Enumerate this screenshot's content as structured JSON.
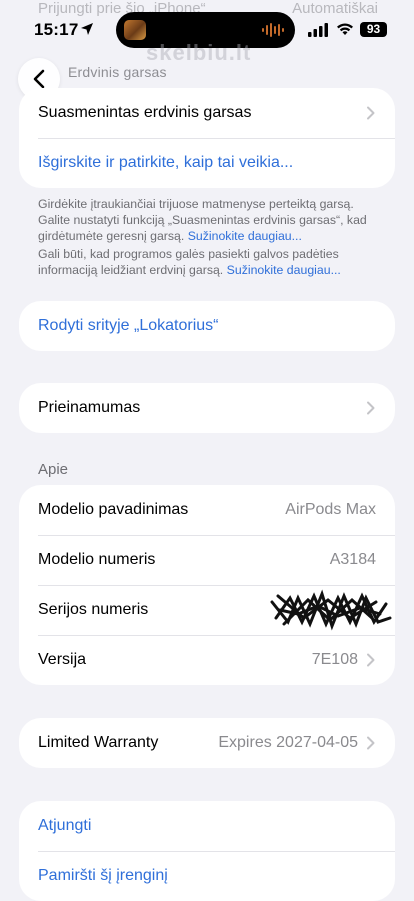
{
  "ghost_header": {
    "label": "Prijungti prie šio „iPhone“",
    "value": "Automatiškai"
  },
  "status_bar": {
    "time": "15:17",
    "battery": "93"
  },
  "watermark": "skelbiu.lt",
  "section_cut_title": "Erdvinis garsas",
  "spatial_audio_card": {
    "personalized_label": "Suasmenintas erdvinis garsas",
    "hear_link": "Išgirskite ir patirkite, kaip tai veikia..."
  },
  "footnotes": {
    "first_text": "Girdėkite įtraukiančiai trijuose matmenyse perteiktą garsą. Galite nustatyti funkciją „Suasmenintas erdvinis garsas“, kad girdėtumėte geresnį garsą.",
    "first_link": "Sužinokite daugiau...",
    "second_text": "Gali būti, kad programos galės pasiekti galvos padėties informaciją leidžiant erdvinį garsą.",
    "second_link": "Sužinokite daugiau..."
  },
  "find_my": {
    "label": "Rodyti srityje „Lokatorius“"
  },
  "accessibility": {
    "label": "Prieinamumas"
  },
  "about": {
    "header": "Apie",
    "rows": [
      {
        "label": "Modelio pavadinimas",
        "value": "AirPods Max"
      },
      {
        "label": "Modelio numeris",
        "value": "A3184"
      },
      {
        "label": "Serijos numeris",
        "value": ""
      },
      {
        "label": "Versija",
        "value": "7E108"
      }
    ]
  },
  "warranty": {
    "label": "Limited Warranty",
    "value": "Expires 2027-04-05"
  },
  "actions": {
    "disconnect": "Atjungti",
    "forget": "Pamiršti šį įrenginį"
  },
  "colors": {
    "link": "#2f6fd9",
    "background": "#f2f2f7",
    "card": "#ffffff",
    "secondary": "#8a8a8e"
  }
}
